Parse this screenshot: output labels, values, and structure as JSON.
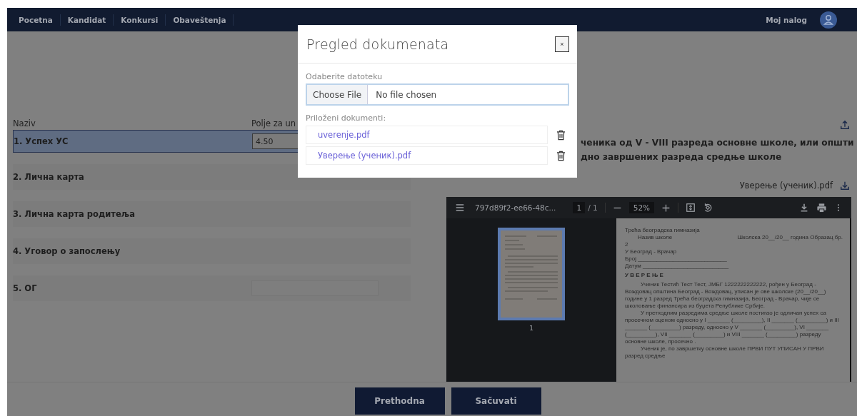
{
  "nav": {
    "items": [
      {
        "label": "Pocetna"
      },
      {
        "label": "Kandidat"
      },
      {
        "label": "Konkursi"
      },
      {
        "label": "Obaveštenja"
      }
    ],
    "account": "Moj nalog"
  },
  "form": {
    "columns": [
      "Naziv",
      "Polje za un"
    ],
    "rows": [
      {
        "label": "1. Успех УС",
        "selected": true,
        "kind": "input",
        "value": "4.50"
      },
      {
        "label": "2. Лична карта",
        "selected": false,
        "kind": "plain"
      },
      {
        "label": "3. Лична карта родитеља",
        "selected": false,
        "kind": "plain"
      },
      {
        "label": "4. Уговор о запослењу",
        "selected": false,
        "kind": "plain"
      },
      {
        "label": "5. ОГ",
        "selected": false,
        "kind": "input"
      }
    ]
  },
  "detail": {
    "title_lines": [
      "ченика од V - VIII разреда основне школе, или општи",
      "дно завршених разреда средње школе"
    ],
    "document": "Уверење (ученик).pdf",
    "viewer": {
      "file": "797d89f2-ee66-48c...",
      "page": "1",
      "page_total": "/ 1",
      "zoom": "52%",
      "thumb_label": "1",
      "page_lines": [
        {
          "kind": "plain",
          "text": "Трећа београдска гимназија"
        },
        {
          "kind": "split",
          "left": "Назив школе",
          "right": "Школска 20__/20__ година     Образац бр."
        },
        {
          "kind": "plain",
          "text": "2"
        },
        {
          "kind": "plain",
          "text": "У Београд - Врачар"
        },
        {
          "kind": "plain",
          "text": "Број ____________________________"
        },
        {
          "kind": "plain",
          "text": "Датум ___________________________"
        },
        {
          "kind": "heading",
          "text": "У В Е Р Е Њ Е"
        },
        {
          "kind": "para",
          "text": "Ученик Тестић Тест Тест, ЈМБГ 1222222222222, рођен у Београд - Вождовац општина Београд - Вождовац, уписан је ове школске (20__/20__) године у 1 разред Трећа београдска гимназија, Београд - Врачар, чије се школовање финансира из буџета Републике Србије."
        },
        {
          "kind": "para",
          "text": "У претходним разредима средње школе постигао је одличан успех са просечном оценом односно у I _______ (_________), II _______ (_________) и III _______ (_________) разреду, односно у V _______ (_________), VI _______ (_________), VII _______ (_________) и VIII _______ (_________) разреду основне школе, просечно ."
        },
        {
          "kind": "para",
          "text": "Ученик је, по завршетку основне школе ПРВИ ПУТ УПИСАН У ПРВИ разред средње"
        }
      ]
    }
  },
  "modal": {
    "title": "Pregled dokumenata",
    "close": "×",
    "file_label": "Odaberite datoteku",
    "choose_button": "Choose File",
    "file_status": "No file chosen",
    "attached_label": "Priloženi dokumenti:",
    "attachments": [
      {
        "name": "uverenje.pdf"
      },
      {
        "name": "Уверење (ученик).pdf"
      }
    ]
  },
  "buttons": [
    "Prethodna",
    "Sačuvati"
  ]
}
